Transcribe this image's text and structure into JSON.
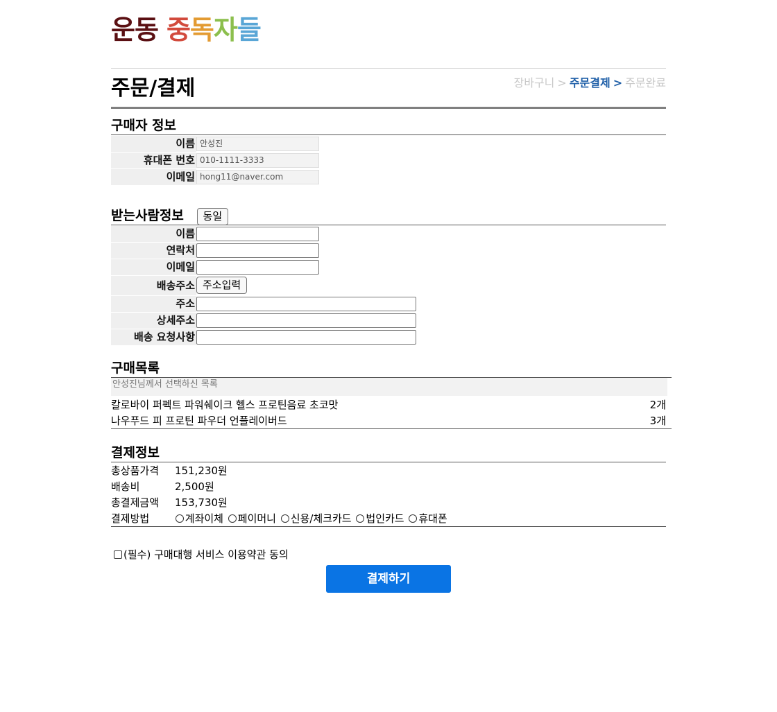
{
  "logo": {
    "chars": [
      {
        "text": "운",
        "color": "#5a0f12"
      },
      {
        "text": "동",
        "color": "#5a0f12"
      },
      {
        "text": " ",
        "color": "#5a0f12"
      },
      {
        "text": "중",
        "color": "#d24a3c"
      },
      {
        "text": "독",
        "color": "#e39b32"
      },
      {
        "text": "자",
        "color": "#8cbf4d"
      },
      {
        "text": "들",
        "color": "#59a6d6"
      }
    ]
  },
  "header": {
    "title": "주문/결제",
    "steps": {
      "cart": "장바구니",
      "sep1": ">",
      "checkout": "주문결제",
      "sep2": ">",
      "complete": "주문완료"
    }
  },
  "buyer": {
    "title": "구매자 정보",
    "name_label": "이름",
    "name_value": "안성진",
    "phone_label": "휴대폰 번호",
    "phone_value": "010-1111-3333",
    "email_label": "이메일",
    "email_value": "hong11@naver.com"
  },
  "receiver": {
    "title": "받는사람정보",
    "same_button": "동일",
    "name_label": "이름",
    "contact_label": "연락처",
    "email_label": "이메일",
    "address_label": "배송주소",
    "address_button": "주소입력",
    "addr_label": "주소",
    "detail_label": "상세주소",
    "request_label": "배송 요청사항"
  },
  "orders": {
    "title": "구매목록",
    "subtitle": "안성진님께서 선택하신 목록",
    "items": [
      {
        "name": "칼로바이 퍼펙트 파워쉐이크 헬스 프로틴음료 초코맛",
        "qty": "2개"
      },
      {
        "name": "나우푸드 피 프로틴 파우더 언플레이버드",
        "qty": "3개"
      }
    ]
  },
  "payment": {
    "title": "결제정보",
    "product_total_label": "총상품가격",
    "product_total_value": "151,230원",
    "shipping_label": "배송비",
    "shipping_value": "2,500원",
    "grand_total_label": "총결제금액",
    "grand_total_value": "153,730원",
    "method_label": "결제방법",
    "methods": [
      "계좌이체",
      "페이머니",
      "신용/체크카드",
      "법인카드",
      "휴대폰"
    ]
  },
  "agreement": {
    "label": "(필수) 구매대행 서비스 이용약관 동의"
  },
  "submit": {
    "label": "결제하기",
    "color": "#0a74e4"
  }
}
